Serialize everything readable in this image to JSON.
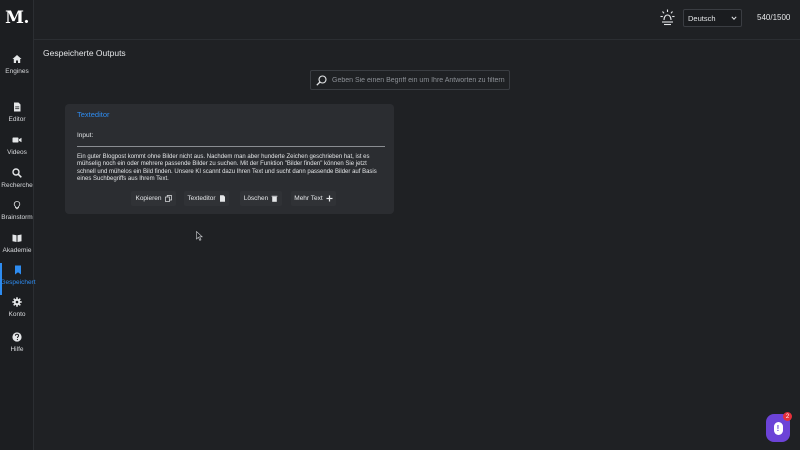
{
  "app": {
    "logo": "M."
  },
  "sidebar": {
    "items": [
      {
        "label": "Engines",
        "icon": "home-icon",
        "active": false
      },
      {
        "label": "Editor",
        "icon": "document-icon",
        "active": false
      },
      {
        "label": "Videos",
        "icon": "video-camera-icon",
        "active": false
      },
      {
        "label": "Recherche",
        "icon": "search-icon",
        "active": false
      },
      {
        "label": "Brainstorm",
        "icon": "lightbulb-icon",
        "active": false
      },
      {
        "label": "Akademie",
        "icon": "book-icon",
        "active": false
      },
      {
        "label": "Gespeichert",
        "icon": "bookmark-icon",
        "active": true
      },
      {
        "label": "Konto",
        "icon": "gear-icon",
        "active": false
      },
      {
        "label": "Hilfe",
        "icon": "question-icon",
        "active": false
      }
    ]
  },
  "topbar": {
    "lamp_icon": "sun-lamp-icon",
    "language": {
      "selected": "Deutsch"
    },
    "credits": "540/1500"
  },
  "main": {
    "title": "Gespeicherte Outputs",
    "search": {
      "placeholder": "Geben Sie einen Begriff ein um Ihre Antworten zu filtern",
      "value": ""
    }
  },
  "card": {
    "title": "Texteditor",
    "input_label": "Input:",
    "body": "Ein guter Blogpost kommt ohne Bilder nicht aus. Nachdem man aber hunderte Zeichen geschrieben hat, ist es mühselig noch ein oder mehrere passende Bilder zu suchen. Mit der Funktion \"Bilder finden\" können Sie jetzt schnell und mühelos ein Bild finden. Unsere KI scannt dazu Ihren Text und sucht dann passende Bilder auf Basis eines Suchbegriffs aus Ihrem Text.",
    "actions": {
      "copy": "Kopieren",
      "editor": "Texteditor",
      "delete": "Löschen",
      "more": "Mehr Text"
    }
  },
  "help": {
    "badge_count": "2"
  },
  "colors": {
    "accent": "#2e8cf0",
    "background": "#1f2124",
    "card": "#2b2d31",
    "help_bubble": "#6c43d7",
    "badge": "#e5303a"
  }
}
